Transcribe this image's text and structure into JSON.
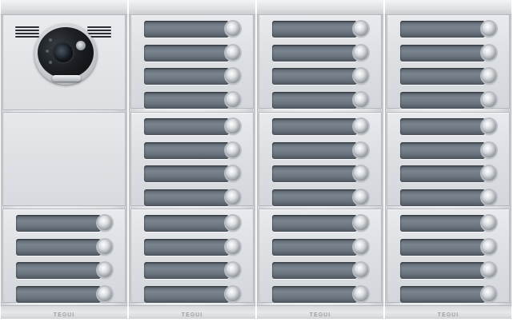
{
  "panel": {
    "brand": "TEGUI",
    "colors": {
      "aluminium": "#e4e6e9",
      "nameplate": "#6a747e",
      "button": "#d9dcdf",
      "camera": "#1c1f23"
    },
    "layout_summary": {
      "columns": 4,
      "modules_per_column": 3,
      "buttons_per_module": 4
    },
    "columns": [
      {
        "modules": [
          "camera",
          "blank",
          "buttons"
        ]
      },
      {
        "modules": [
          "buttons",
          "buttons",
          "buttons"
        ]
      },
      {
        "modules": [
          "buttons",
          "buttons",
          "buttons"
        ]
      },
      {
        "modules": [
          "buttons",
          "buttons",
          "buttons"
        ]
      }
    ],
    "icons": {
      "camera": "camera-icon",
      "speaker": "speaker-grille-icon",
      "call_button": "call-button-icon"
    }
  }
}
